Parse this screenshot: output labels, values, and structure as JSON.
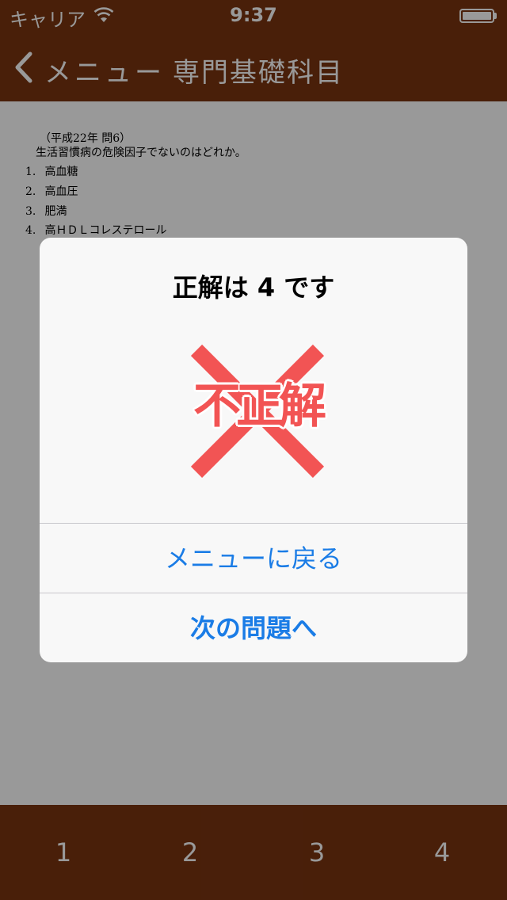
{
  "status_bar": {
    "carrier": "キャリア",
    "time": "9:37"
  },
  "nav": {
    "back_label": "メニュー",
    "title": "専門基礎科目"
  },
  "question": {
    "meta": "（平成22年 問6）",
    "text": "生活習慣病の危険因子でないのはどれか。",
    "choices": [
      {
        "num": "1.",
        "label": "高血糖"
      },
      {
        "num": "2.",
        "label": "高血圧"
      },
      {
        "num": "3.",
        "label": "肥満"
      },
      {
        "num": "4.",
        "label": "高ＨＤＬコレステロール"
      }
    ]
  },
  "tabs": [
    "1",
    "2",
    "3",
    "4"
  ],
  "alert": {
    "title": "正解は 4 です",
    "stamp_text": "不正解",
    "menu_button": "メニューに戻る",
    "next_button": "次の問題へ"
  },
  "colors": {
    "brand": "#7a3410",
    "accent": "#1a7ce6",
    "incorrect": "#f25454"
  }
}
